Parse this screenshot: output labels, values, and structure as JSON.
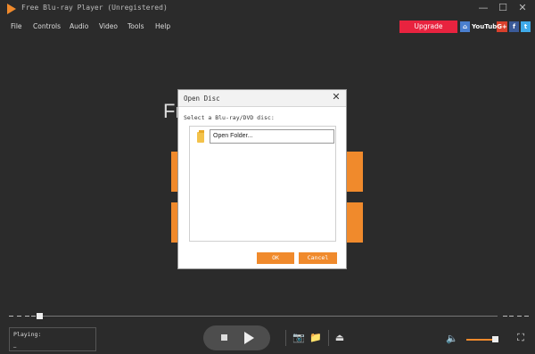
{
  "window": {
    "title": "Free Blu-ray Player (Unregistered)",
    "minimize_glyph": "—",
    "maximize_glyph": "☐",
    "close_glyph": "✕"
  },
  "menu": {
    "items": [
      "File",
      "Controls",
      "Audio",
      "Video",
      "Tools",
      "Help"
    ]
  },
  "header": {
    "upgrade_label": "Upgrade",
    "social": [
      {
        "name": "home-icon",
        "label": "⌂"
      },
      {
        "name": "youtube-icon",
        "label": "YouTube"
      },
      {
        "name": "google-plus-icon",
        "label": "G+"
      },
      {
        "name": "facebook-icon",
        "label": "f"
      },
      {
        "name": "twitter-icon",
        "label": "t"
      }
    ]
  },
  "background": {
    "title_fragment": "Fr"
  },
  "dialog": {
    "title": "Open Disc",
    "close_glyph": "✕",
    "prompt": "Select a Blu-ray/DVD disc:",
    "items": [
      {
        "label": "Open Folder..."
      }
    ],
    "ok_label": "OK",
    "cancel_label": "Cancel"
  },
  "status": {
    "label": "Playing:",
    "value": "_"
  },
  "colors": {
    "accent": "#f08a2c",
    "upgrade": "#e8233f",
    "background": "#2b2b2b"
  },
  "icons": {
    "camera": "📷",
    "folder": "📁",
    "eject": "⏏",
    "volume": "🔈",
    "fullscreen": "⛶"
  },
  "volume": {
    "level": 0.85
  },
  "timeline": {
    "progress": 0.0
  }
}
